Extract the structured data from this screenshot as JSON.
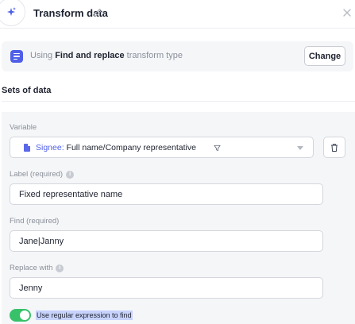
{
  "header": {
    "title": "Transform data",
    "logo_icon": "sparkle-icon",
    "edit_icon": "pencil-icon",
    "close_icon": "close-icon"
  },
  "transform_type": {
    "prefix": "Using",
    "name": "Find and replace",
    "suffix": "transform type",
    "change_label": "Change",
    "accent_color": "#4f5fe8"
  },
  "sets_of_data": {
    "title": "Sets of data",
    "variable": {
      "label": "Variable",
      "selected_prefix": "Signee:",
      "selected_value": "Full name/Company representative"
    },
    "label_field": {
      "label": "Label (required)",
      "value": "Fixed representative name"
    },
    "find_field": {
      "label": "Find (required)",
      "value": "Jane|Janny"
    },
    "replace_field": {
      "label": "Replace with",
      "value": "Jenny"
    },
    "regex_toggle": {
      "label": "Use regular expression to find",
      "on": true,
      "color": "#37c26a"
    }
  }
}
